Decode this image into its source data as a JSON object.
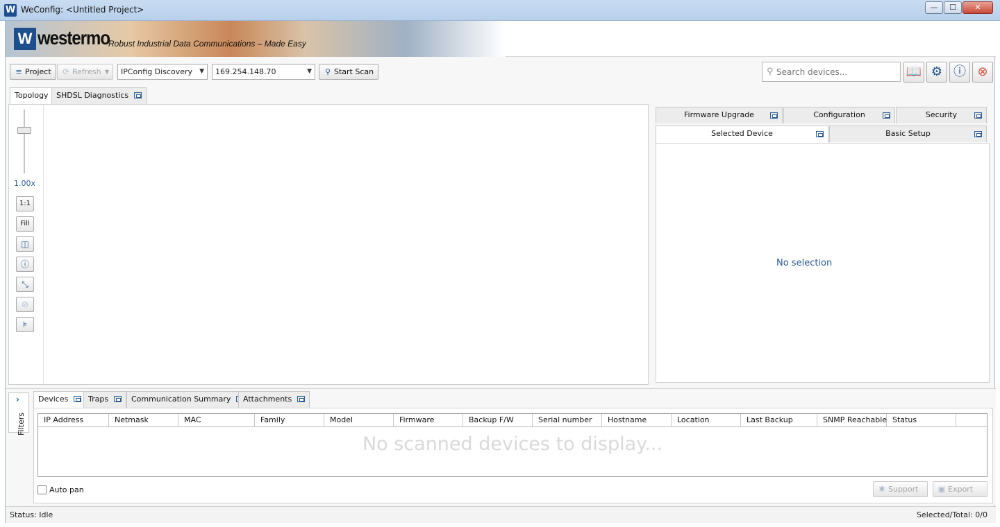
{
  "window": {
    "title": "WeConfig: <Untitled Project>",
    "app_icon": "W",
    "controls": {
      "minimize": "—",
      "maximize": "☐",
      "close": "✕"
    }
  },
  "banner": {
    "logo_mark": "W",
    "logo_text": "westermo",
    "tagline": "Robust Industrial Data Communications – Made Easy"
  },
  "toolbar": {
    "project_label": "Project",
    "refresh_label": "Refresh",
    "discovery_method": "IPConfig Discovery",
    "ip_address": "169.254.148.70",
    "start_scan_label": "Start Scan",
    "search_placeholder": "Search devices...",
    "icons": [
      "manual-icon",
      "settings-icon",
      "info-icon",
      "exit-icon"
    ]
  },
  "main_tabs": [
    "Topology",
    "SHDSL Diagnostics"
  ],
  "zoom": {
    "level": "1.00x",
    "buttons": [
      "1:1",
      "Fill"
    ]
  },
  "right_panel": {
    "top_tabs": [
      "Firmware Upgrade",
      "Configuration",
      "Security"
    ],
    "second_tabs": [
      "Selected Device",
      "Basic Setup"
    ],
    "empty_text": "No selection"
  },
  "bottom": {
    "filters_label": "Filters",
    "tabs": [
      "Devices",
      "Traps",
      "Communication Summary",
      "Attachments"
    ],
    "columns": [
      "IP Address",
      "Netmask",
      "MAC",
      "Family",
      "Model",
      "Firmware",
      "Backup F/W",
      "Serial number",
      "Hostname",
      "Location",
      "Last Backup",
      "SNMP Reachable",
      "Status"
    ],
    "empty_message": "No scanned devices to display...",
    "auto_pan_label": "Auto pan",
    "support_label": "Support",
    "export_label": "Export"
  },
  "status": {
    "left": "Status: Idle",
    "right": "Selected/Total: 0/0"
  }
}
